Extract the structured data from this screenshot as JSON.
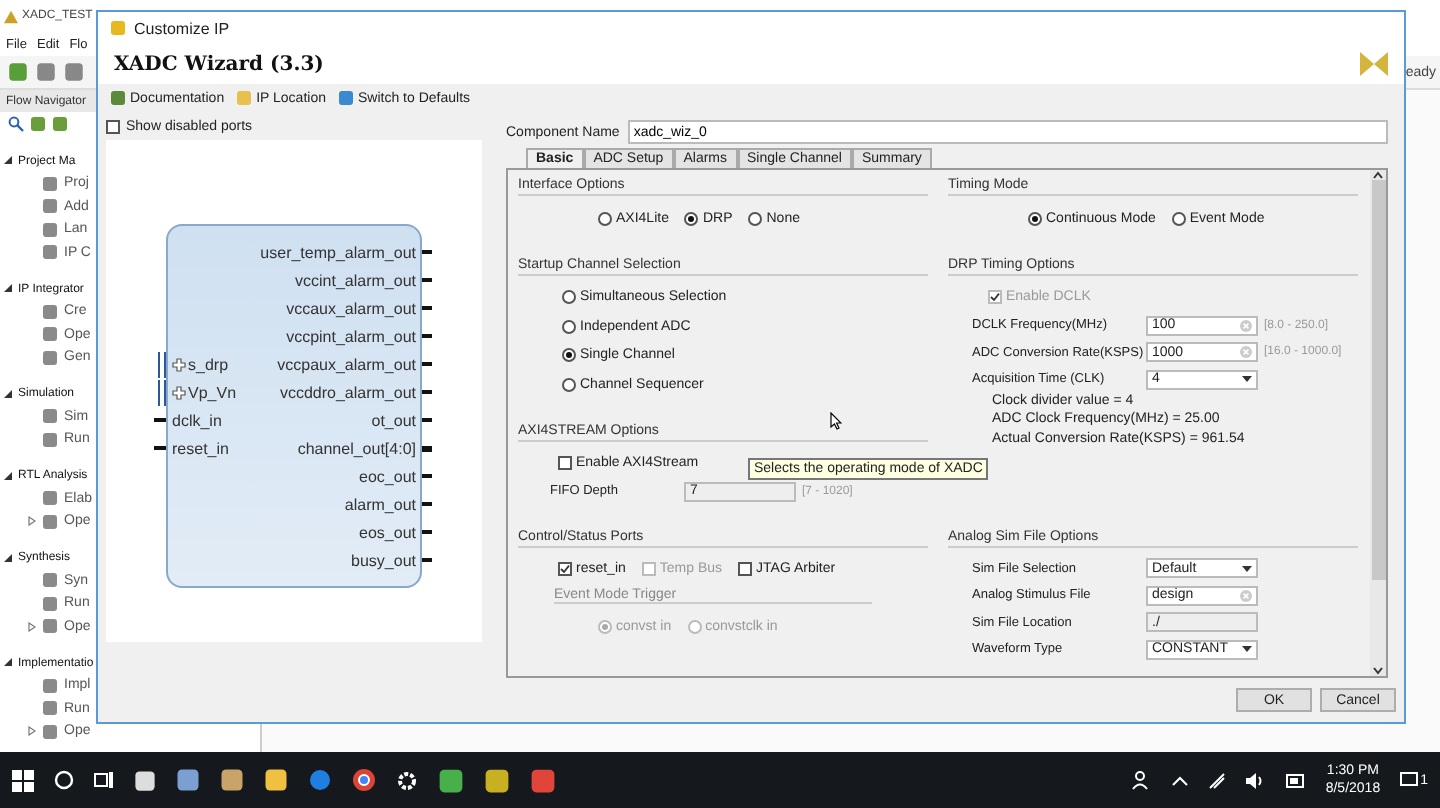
{
  "background_app": {
    "title": "XADC_TEST",
    "menu": [
      "File",
      "Edit",
      "Flo"
    ],
    "status": "eady",
    "flow_navigator": {
      "title": "Flow Navigator",
      "sections": [
        {
          "label": "Project Ma",
          "expanded": true,
          "items": [
            {
              "label": "Proj",
              "expandable": false
            },
            {
              "label": "Add",
              "expandable": false
            },
            {
              "label": "Lan",
              "expandable": false
            },
            {
              "label": "IP C",
              "expandable": false
            }
          ]
        },
        {
          "label": "IP Integrator",
          "expanded": true,
          "items": [
            {
              "label": "Cre",
              "expandable": false
            },
            {
              "label": "Ope",
              "expandable": false
            },
            {
              "label": "Gen",
              "expandable": false
            }
          ]
        },
        {
          "label": "Simulation",
          "expanded": true,
          "items": [
            {
              "label": "Sim",
              "expandable": false
            },
            {
              "label": "Run",
              "expandable": false
            }
          ]
        },
        {
          "label": "RTL Analysis",
          "expanded": true,
          "items": [
            {
              "label": "Elab",
              "expandable": false
            },
            {
              "label": "Ope",
              "expandable": true
            }
          ]
        },
        {
          "label": "Synthesis",
          "expanded": true,
          "items": [
            {
              "label": "Syn",
              "expandable": false
            },
            {
              "label": "Run",
              "expandable": false
            },
            {
              "label": "Ope",
              "expandable": true
            }
          ]
        },
        {
          "label": "Implementatio",
          "expanded": true,
          "items": [
            {
              "label": "Impl",
              "expandable": false
            },
            {
              "label": "Run",
              "expandable": false
            },
            {
              "label": "Ope",
              "expandable": true
            }
          ]
        }
      ]
    }
  },
  "dialog": {
    "title": "Customize IP",
    "heading": "XADC Wizard (3.3)",
    "toolbar": [
      "Documentation",
      "IP Location",
      "Switch to Defaults"
    ],
    "show_disabled_ports": {
      "label": "Show disabled ports",
      "checked": false
    },
    "symbol": {
      "inputs": [
        {
          "name": "s_drp",
          "kind": "bus"
        },
        {
          "name": "Vp_Vn",
          "kind": "bus"
        },
        {
          "name": "dclk_in",
          "kind": "pin"
        },
        {
          "name": "reset_in",
          "kind": "pin"
        }
      ],
      "outputs": [
        {
          "name": "user_temp_alarm_out",
          "kind": "pin"
        },
        {
          "name": "vccint_alarm_out",
          "kind": "pin"
        },
        {
          "name": "vccaux_alarm_out",
          "kind": "pin"
        },
        {
          "name": "vccpint_alarm_out",
          "kind": "pin"
        },
        {
          "name": "vccpaux_alarm_out",
          "kind": "pin"
        },
        {
          "name": "vccddro_alarm_out",
          "kind": "pin"
        },
        {
          "name": "ot_out",
          "kind": "pin"
        },
        {
          "name": "channel_out[4:0]",
          "kind": "bus"
        },
        {
          "name": "eoc_out",
          "kind": "pin"
        },
        {
          "name": "alarm_out",
          "kind": "pin"
        },
        {
          "name": "eos_out",
          "kind": "pin"
        },
        {
          "name": "busy_out",
          "kind": "pin"
        }
      ]
    },
    "component_name": {
      "label": "Component Name",
      "value": "xadc_wiz_0"
    },
    "tabs": [
      {
        "label": "Basic",
        "selected": true
      },
      {
        "label": "ADC Setup",
        "selected": false
      },
      {
        "label": "Alarms",
        "selected": false
      },
      {
        "label": "Single Channel",
        "selected": false
      },
      {
        "label": "Summary",
        "selected": false
      }
    ],
    "panel_rows": [
      {
        "left": [
          {
            "title": "Interface Options",
            "rows": [
              {
                "kind": "radio_row",
                "disabled": false,
                "options": [
                  {
                    "label": "AXI4Lite",
                    "selected": false
                  },
                  {
                    "label": "DRP",
                    "selected": true
                  },
                  {
                    "label": "None",
                    "selected": false
                  }
                ]
              }
            ]
          }
        ],
        "right": [
          {
            "title": "Timing Mode",
            "rows": [
              {
                "kind": "radio_row",
                "disabled": false,
                "options": [
                  {
                    "label": "Continuous Mode",
                    "selected": true
                  },
                  {
                    "label": "Event Mode",
                    "selected": false
                  }
                ]
              }
            ]
          }
        ]
      },
      {
        "left": [
          {
            "title": "Startup Channel Selection",
            "rows": [
              {
                "kind": "radio",
                "label": "Simultaneous Selection",
                "selected": false
              },
              {
                "kind": "radio",
                "label": "Independent ADC",
                "selected": false
              },
              {
                "kind": "radio",
                "label": "Single Channel",
                "selected": true
              },
              {
                "kind": "radio",
                "label": "Channel Sequencer",
                "selected": false
              }
            ]
          },
          {
            "title": "AXI4STREAM Options",
            "rows": [
              {
                "kind": "checkbox",
                "label": "Enable AXI4Stream",
                "checked": false,
                "disabled": false
              },
              {
                "kind": "disabled_field",
                "label": "FIFO Depth",
                "value": "7",
                "range": "[7 - 1020]"
              }
            ]
          }
        ],
        "right": [
          {
            "title": "DRP Timing Options",
            "rows": [
              {
                "kind": "checkbox",
                "label": "Enable DCLK",
                "checked": true,
                "disabled": true
              },
              {
                "kind": "clearable_field",
                "label": "DCLK Frequency(MHz)",
                "value": "100",
                "range": "[8.0 - 250.0]"
              },
              {
                "kind": "clearable_field",
                "label": "ADC Conversion Rate(KSPS)",
                "value": "1000",
                "range": "[16.0 - 1000.0]"
              },
              {
                "kind": "select_field",
                "label": "Acquisition Time (CLK)",
                "value": "4"
              },
              {
                "kind": "text",
                "label": "Clock divider value = 4"
              },
              {
                "kind": "text",
                "label": "ADC Clock Frequency(MHz) = 25.00"
              },
              {
                "kind": "text",
                "label": "Actual Conversion Rate(KSPS) = 961.54"
              }
            ]
          }
        ]
      },
      {
        "left": [
          {
            "title": "Control/Status Ports",
            "rows": [
              {
                "kind": "checkbox_row",
                "options": [
                  {
                    "label": "reset_in",
                    "checked": true,
                    "disabled": false
                  },
                  {
                    "label": "Temp Bus",
                    "checked": false,
                    "disabled": true
                  },
                  {
                    "label": "JTAG Arbiter",
                    "checked": false,
                    "disabled": false
                  }
                ]
              },
              {
                "kind": "subheading",
                "label": "Event Mode Trigger"
              },
              {
                "kind": "radio_row",
                "disabled": true,
                "options": [
                  {
                    "label": "convst in",
                    "selected": true
                  },
                  {
                    "label": "convstclk in",
                    "selected": false
                  }
                ]
              }
            ]
          }
        ],
        "right": [
          {
            "title": "Analog Sim File Options",
            "rows": [
              {
                "kind": "select_field",
                "label": "Sim File Selection",
                "value": "Default"
              },
              {
                "kind": "clearable_field",
                "label": "Analog Stimulus File",
                "value": "design"
              },
              {
                "kind": "disabled_field",
                "label": "Sim File Location",
                "value": "./"
              },
              {
                "kind": "select_field",
                "label": "Waveform Type",
                "value": "CONSTANT"
              }
            ]
          }
        ]
      }
    ],
    "tooltip": "Selects the operating mode of XADC",
    "buttons": [
      "OK",
      "Cancel"
    ]
  },
  "taskbar": {
    "time": "1:30 PM",
    "date": "8/5/2018",
    "notifications": "1"
  }
}
